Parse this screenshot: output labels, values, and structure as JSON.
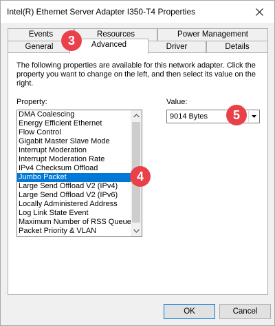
{
  "window": {
    "title": "Intel(R) Ethernet Server Adapter I350-T4 Properties",
    "close_glyph": "✕"
  },
  "tabs": {
    "back_row": [
      "Events",
      "Resources",
      "Power Management"
    ],
    "front_row": [
      "General",
      "Advanced",
      "Driver",
      "Details"
    ],
    "active": "Advanced"
  },
  "panel": {
    "description": "The following properties are available for this network adapter. Click the property you want to change on the left, and then select its value on the right.",
    "property_label": "Property:",
    "value_label": "Value:",
    "properties": [
      "DMA Coalescing",
      "Energy Efficient Ethernet",
      "Flow Control",
      "Gigabit Master Slave Mode",
      "Interrupt Moderation",
      "Interrupt Moderation Rate",
      "IPv4 Checksum Offload",
      "Jumbo Packet",
      "Large Send Offload V2 (IPv4)",
      "Large Send Offload V2 (IPv6)",
      "Locally Administered Address",
      "Log Link State Event",
      "Maximum Number of RSS Queues",
      "Packet Priority & VLAN"
    ],
    "selected_property": "Jumbo Packet",
    "value": "9014 Bytes"
  },
  "badges": [
    "3",
    "4",
    "5"
  ],
  "buttons": {
    "ok": "OK",
    "cancel": "Cancel"
  },
  "colors": {
    "accent": "#0078d7",
    "badge": "#e8414a"
  }
}
